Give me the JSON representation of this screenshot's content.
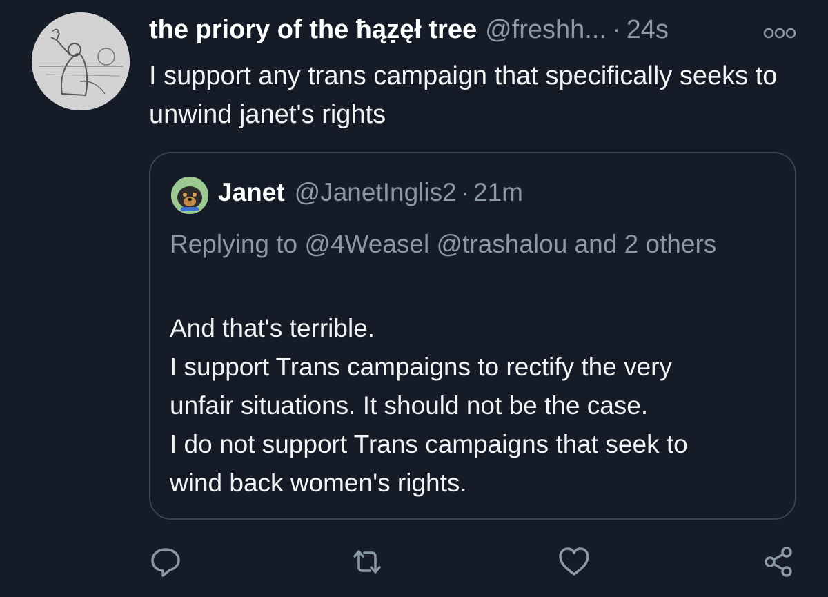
{
  "tweet": {
    "display_name": "the priory of the ħąẓęł tree",
    "handle": "@freshh...",
    "separator": "·",
    "time": "24s",
    "text": "I support any trans campaign that specifically seeks to unwind janet's rights",
    "more_icon": "more-options-icon"
  },
  "quoted": {
    "display_name": "Janet",
    "handle": "@JanetInglis2",
    "separator": "·",
    "time": "21m",
    "replying_to": "Replying to @4Weasel @trashalou and 2 others",
    "lines": [
      "And that's terrible.",
      "I support Trans campaigns to rectify the very",
      "unfair situations. It should not be the case.",
      "I do not support Trans campaigns that seek to",
      "wind back women's rights."
    ]
  },
  "actions": {
    "reply_icon": "reply-icon",
    "retweet_icon": "retweet-icon",
    "like_icon": "heart-icon",
    "share_icon": "share-icon"
  },
  "colors": {
    "background": "#151c28",
    "secondary_text": "#8b98a5",
    "border": "#38444d"
  }
}
